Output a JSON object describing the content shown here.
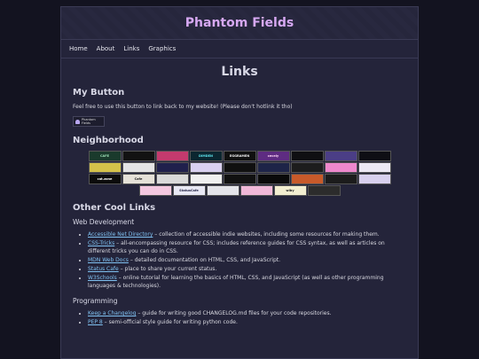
{
  "site": {
    "title": "Phantom Fields"
  },
  "nav": [
    {
      "label": "Home"
    },
    {
      "label": "About"
    },
    {
      "label": "Links"
    },
    {
      "label": "Graphics"
    }
  ],
  "page": {
    "title": "Links"
  },
  "my_button": {
    "heading": "My Button",
    "text": "Feel free to use this button to link back to my website! (Please don't hotlink it tho)",
    "badge_line1": "Phantom",
    "badge_line2": "Fields"
  },
  "neighborhood": {
    "heading": "Neighborhood",
    "buttons": [
      {
        "label": "CAFE",
        "bg": "#1a3a2c",
        "fg": "#9fe2b8"
      },
      {
        "label": "",
        "bg": "#121212",
        "fg": "#ddd"
      },
      {
        "label": "",
        "bg": "#c43a6e",
        "fg": "#ffd"
      },
      {
        "label": "DIMDEN",
        "bg": "#0b2630",
        "fg": "#5fe8f0"
      },
      {
        "label": "EGGRAMEN",
        "bg": "#101010",
        "fg": "#f4f4f4"
      },
      {
        "label": "cecely",
        "bg": "#5e2c82",
        "fg": "#ffd6f7"
      },
      {
        "label": "",
        "bg": "#0f0f12",
        "fg": "#7f7"
      },
      {
        "label": "",
        "bg": "#4b3e86",
        "fg": "#e8e0ff"
      },
      {
        "label": "",
        "bg": "#0e0e14",
        "fg": "#9fd"
      },
      {
        "label": "",
        "bg": "#d4c24a",
        "fg": "#111"
      },
      {
        "label": "",
        "bg": "#e4e4e4",
        "fg": "#222"
      },
      {
        "label": "",
        "bg": "#20204c",
        "fg": "#bbf"
      },
      {
        "label": "",
        "bg": "#d9d0f0",
        "fg": "#333"
      },
      {
        "label": "",
        "bg": "#101010",
        "fg": "#fff"
      },
      {
        "label": "",
        "bg": "#1e2448",
        "fg": "#8cf"
      },
      {
        "label": "",
        "bg": "#1d1d1d",
        "fg": "#fff"
      },
      {
        "label": "",
        "bg": "#ee88cc",
        "fg": "#fff"
      },
      {
        "label": "",
        "bg": "#ece8f4",
        "fg": "#333"
      },
      {
        "label": "cat.zone",
        "bg": "#0c0c0c",
        "fg": "#fff"
      },
      {
        "label": "Cafe",
        "bg": "#e6e2d8",
        "fg": "#222"
      },
      {
        "label": "",
        "bg": "#dadada",
        "fg": "#222"
      },
      {
        "label": "",
        "bg": "#f0f0f0",
        "fg": "#222"
      },
      {
        "label": "",
        "bg": "#111111",
        "fg": "#f9c"
      },
      {
        "label": "",
        "bg": "#0a0a0a",
        "fg": "#fff"
      },
      {
        "label": "",
        "bg": "#c85a2a",
        "fg": "#fff"
      },
      {
        "label": "",
        "bg": "#1c1c1c",
        "fg": "#fc6"
      },
      {
        "label": "",
        "bg": "#d8d0ee",
        "fg": "#333"
      },
      {
        "label": "",
        "bg": "#f4c8e0",
        "fg": "#733"
      },
      {
        "label": "StatusCafe",
        "bg": "#e8e8f4",
        "fg": "#224"
      },
      {
        "label": "",
        "bg": "#e4e4ea",
        "fg": "#224"
      },
      {
        "label": "",
        "bg": "#f0b8d8",
        "fg": "#636"
      },
      {
        "label": "wiby",
        "bg": "#f2eed0",
        "fg": "#222"
      },
      {
        "label": "",
        "bg": "#2c2c2c",
        "fg": "#ddd"
      }
    ]
  },
  "other": {
    "heading": "Other Cool Links",
    "webdev": {
      "heading": "Web Development",
      "items": [
        {
          "link": "Accessible Net Directory",
          "desc": " – collection of accessible indie websites, including some resources for making them."
        },
        {
          "link": "CSS-Tricks",
          "desc": " – all-encompassing resource for CSS; includes reference guides for CSS syntax, as well as articles on different tricks you can do in CSS."
        },
        {
          "link": "MDN Web Docs",
          "desc": " – detailed documentation on HTML, CSS, and JavaScript."
        },
        {
          "link": "Status Cafe",
          "desc": " – place to share your current status."
        },
        {
          "link": "W3Schools",
          "desc": " – online tutorial for learning the basics of HTML, CSS, and JavaScript (as well as other programming languages & technologies)."
        }
      ]
    },
    "programming": {
      "heading": "Programming",
      "items": [
        {
          "link": "Keep a Changelog",
          "desc": " – guide for writing good CHANGELOG.md files for your code repositories."
        },
        {
          "link": "PEP 8",
          "desc": " – semi-official style guide for writing python code."
        }
      ]
    }
  }
}
